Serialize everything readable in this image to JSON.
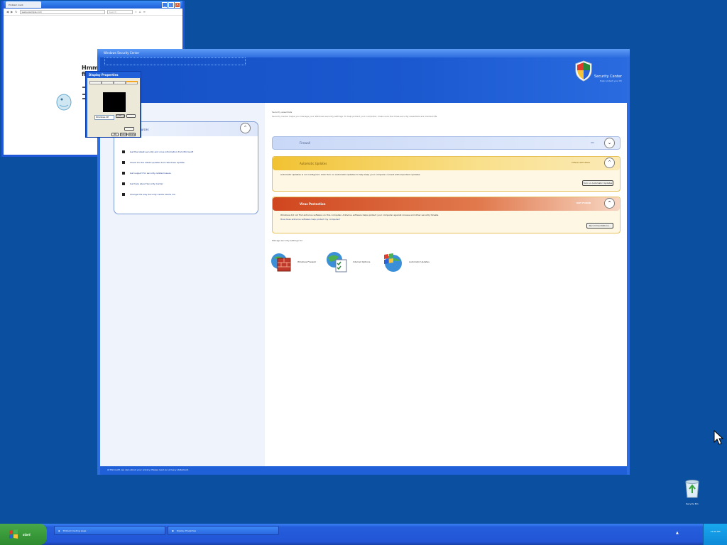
{
  "browser": {
    "tab_label": "Problem loadi",
    "url": "www.example.com",
    "search_placeholder": "Search",
    "error_title_line1": "Hmm. W",
    "error_title_line2": "finding"
  },
  "dialog": {
    "title": "Display Properties",
    "select_value": "Windows XP",
    "btn_settings": "Settings",
    "btn_apply": "Apply",
    "btn_ok": "OK",
    "btn_cancel": "Cancel"
  },
  "security_center": {
    "window_title": "Windows Security Center",
    "brand": "Security Center",
    "brand_sub": "Help protect your PC",
    "resources": {
      "title": "Resources",
      "items": [
        "Get the latest security and virus information from Microsoft",
        "Check for the latest updates from Windows Update",
        "Get support for security-related issues",
        "Get help about Security Center",
        "Change the way Security Center alerts me"
      ]
    },
    "intro": "Security essentials",
    "intro_detail": "Security Center helps you manage your Windows security settings. To help protect your computer, make sure the three security essentials are marked ON.",
    "panels": [
      {
        "title": "Firewall",
        "status": "ON"
      },
      {
        "title": "Automatic Updates",
        "status": "CHECK SETTINGS",
        "desc": "Automatic Updates is not configured. Click Turn on Automatic Updates to help keep your computer current with important updates.",
        "button": "Turn on Automatic Updates"
      },
      {
        "title": "Virus Protection",
        "status": "NOT FOUND",
        "desc": "Windows did not find antivirus software on this computer. Antivirus software helps protect your computer against viruses and other security threats.",
        "desc2": "How does antivirus software help protect my computer?",
        "button": "Recommendations..."
      }
    ],
    "manage_label": "Manage security settings for:",
    "tools": [
      "Windows Firewall",
      "Internet Options",
      "Automatic Updates"
    ],
    "footer": "At Microsoft, we care about your privacy. Please read our privacy statement."
  },
  "desktop": {
    "recycle_bin": "Recycle Bin"
  },
  "taskbar": {
    "start_label": "start",
    "tasks": [
      "Problem loading page",
      "Display Properties"
    ],
    "clock": "12:00 PM"
  },
  "colors": {
    "desktop": "#0b4fa0",
    "firewall_header": "#c9d8f7",
    "updates_header": "#f1c232",
    "virus_header": "#d0461e"
  }
}
